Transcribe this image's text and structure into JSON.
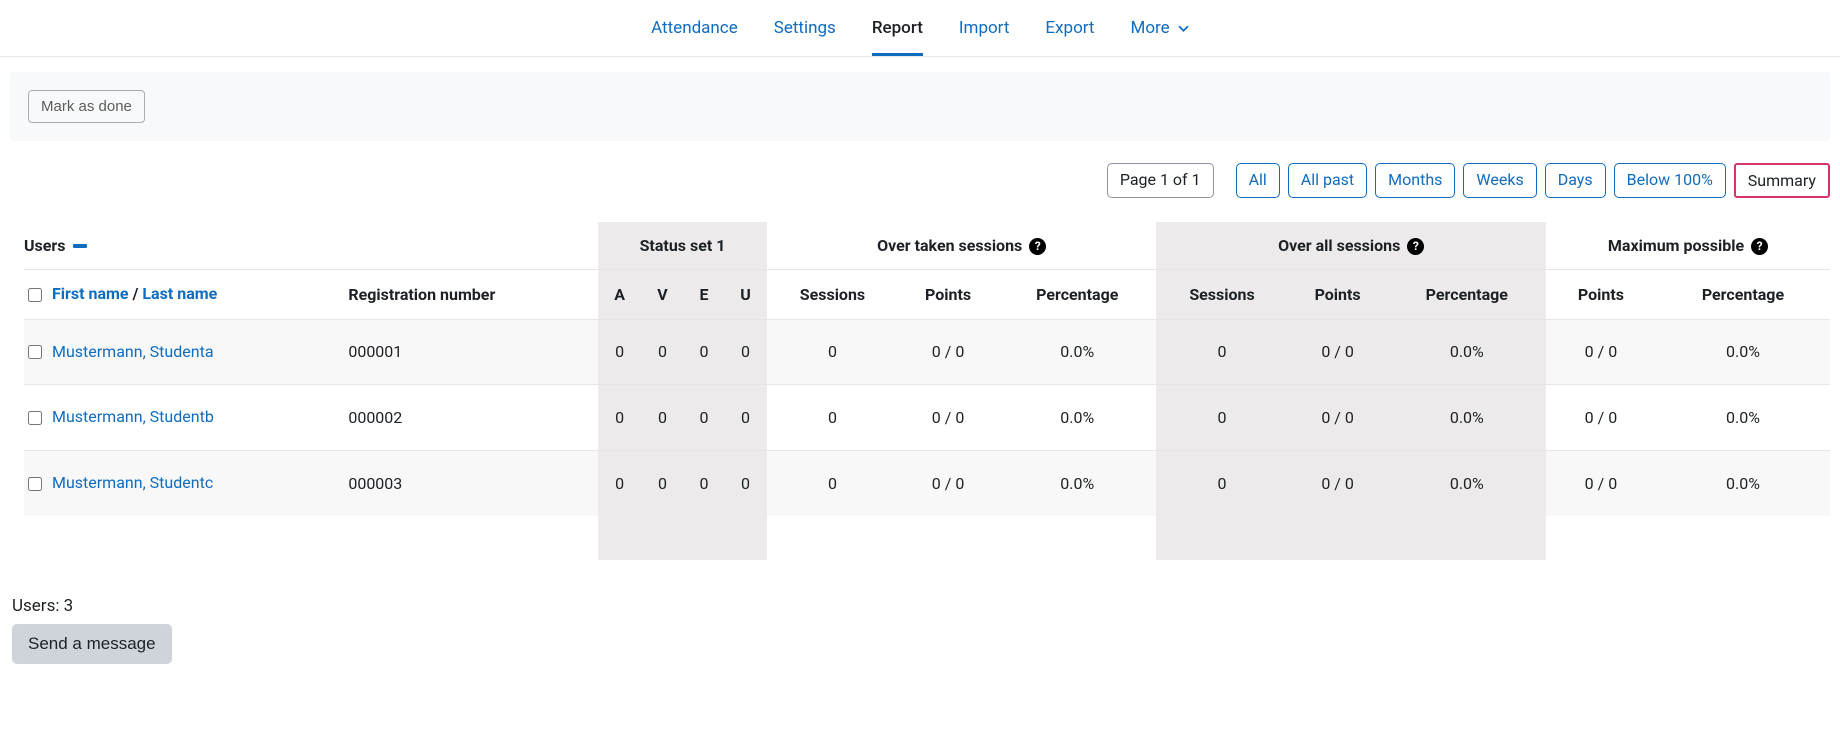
{
  "tabs": {
    "attendance": "Attendance",
    "settings": "Settings",
    "report": "Report",
    "import": "Import",
    "export": "Export",
    "more": "More"
  },
  "mark_done": "Mark as done",
  "filters": {
    "page": "Page 1 of 1",
    "all": "All",
    "all_past": "All past",
    "months": "Months",
    "weeks": "Weeks",
    "days": "Days",
    "below": "Below 100%",
    "summary": "Summary"
  },
  "headers": {
    "users": "Users",
    "status_set": "Status set 1",
    "over_taken": "Over taken sessions",
    "over_all": "Over all sessions",
    "max_possible": "Maximum possible",
    "first_name": "First name",
    "last_name": "Last name",
    "name_sep": " / ",
    "registration": "Registration number",
    "A": "A",
    "V": "V",
    "E": "E",
    "U": "U",
    "sessions": "Sessions",
    "points": "Points",
    "percentage": "Percentage"
  },
  "help_glyph": "?",
  "rows": [
    {
      "name": "Mustermann, Studenta",
      "reg": "000001",
      "A": "0",
      "V": "0",
      "E": "0",
      "U": "0",
      "t_sess": "0",
      "t_pts": "0 / 0",
      "t_pct": "0.0%",
      "a_sess": "0",
      "a_pts": "0 / 0",
      "a_pct": "0.0%",
      "m_pts": "0 / 0",
      "m_pct": "0.0%"
    },
    {
      "name": "Mustermann, Studentb",
      "reg": "000002",
      "A": "0",
      "V": "0",
      "E": "0",
      "U": "0",
      "t_sess": "0",
      "t_pts": "0 / 0",
      "t_pct": "0.0%",
      "a_sess": "0",
      "a_pts": "0 / 0",
      "a_pct": "0.0%",
      "m_pts": "0 / 0",
      "m_pct": "0.0%"
    },
    {
      "name": "Mustermann, Studentc",
      "reg": "000003",
      "A": "0",
      "V": "0",
      "E": "0",
      "U": "0",
      "t_sess": "0",
      "t_pts": "0 / 0",
      "t_pct": "0.0%",
      "a_sess": "0",
      "a_pts": "0 / 0",
      "a_pct": "0.0%",
      "m_pts": "0 / 0",
      "m_pct": "0.0%"
    }
  ],
  "users_count": "Users: 3",
  "send_message": "Send a message"
}
